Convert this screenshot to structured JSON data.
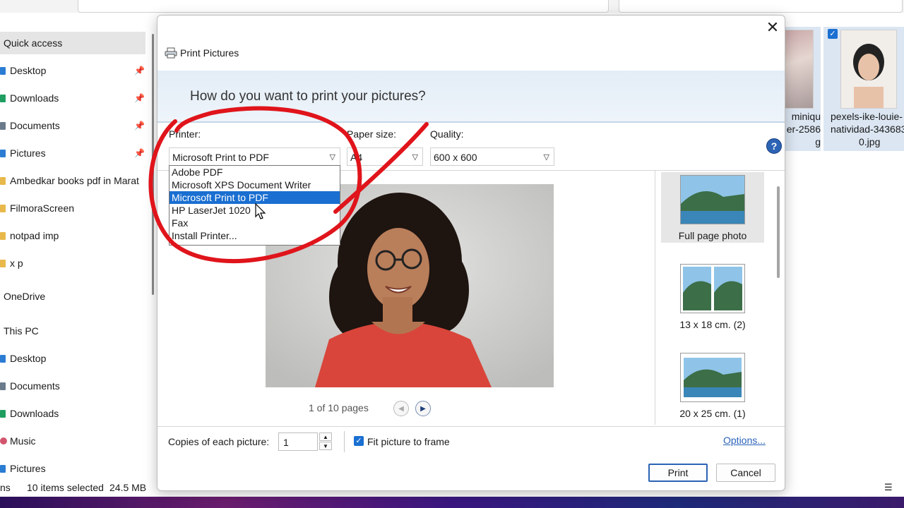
{
  "explorer": {
    "sidebar": {
      "items": [
        {
          "label": "Quick access",
          "color": "#ffffff"
        },
        {
          "label": "Desktop",
          "color": "#2b7cd3"
        },
        {
          "label": "Downloads",
          "color": "#1f9e62"
        },
        {
          "label": "Documents",
          "color": "#6b7b8c"
        },
        {
          "label": "Pictures",
          "color": "#2b7cd3"
        },
        {
          "label": "Ambedkar books pdf in Marat",
          "color": "#e8b84a"
        },
        {
          "label": "FilmoraScreen",
          "color": "#e8b84a"
        },
        {
          "label": "notpad imp",
          "color": "#e8b84a"
        },
        {
          "label": "x p",
          "color": "#e8b84a"
        },
        {
          "label": "OneDrive",
          "color": "#ffffff"
        },
        {
          "label": "This PC",
          "color": "#ffffff"
        },
        {
          "label": "Desktop",
          "color": "#2b7cd3"
        },
        {
          "label": "Documents",
          "color": "#6b7b8c"
        },
        {
          "label": "Downloads",
          "color": "#1f9e62"
        },
        {
          "label": "Music",
          "color": "#d2556d"
        },
        {
          "label": "Pictures",
          "color": "#2b7cd3"
        }
      ],
      "pin_glyph": "📌"
    },
    "thumbnails": [
      {
        "caption_lines": [
          "miniqu",
          "er-2586",
          "g"
        ]
      },
      {
        "caption_lines": [
          "pexels-ike-louie-",
          "natividad-343683",
          "0.jpg"
        ]
      }
    ],
    "status": {
      "prefix": "ns",
      "selection": "10 items selected",
      "size": "24.5 MB"
    }
  },
  "dialog": {
    "title": "Print Pictures",
    "question": "How do you want to print your pictures?",
    "printer": {
      "label": "Printer:",
      "value": "Microsoft Print to PDF"
    },
    "paper": {
      "label": "Paper size:",
      "value": "A4"
    },
    "quality": {
      "label": "Quality:",
      "value": "600 x 600"
    },
    "printer_options": [
      "Adobe PDF",
      "Microsoft XPS Document Writer",
      "Microsoft Print to PDF",
      "HP LaserJet 1020",
      "Fax",
      "Install Printer..."
    ],
    "highlighted_index": 2,
    "pages_text": "1 of 10 pages",
    "layouts": [
      {
        "label": "Full page photo",
        "selected": true
      },
      {
        "label": "13 x 18 cm. (2)",
        "selected": false
      },
      {
        "label": "20 x 25 cm. (1)",
        "selected": false
      }
    ],
    "copies": {
      "label": "Copies of each picture:",
      "value": "1"
    },
    "fit": {
      "label": "Fit picture to frame",
      "checked": true
    },
    "options_link": "Options...",
    "buttons": {
      "print": "Print",
      "cancel": "Cancel"
    },
    "close_glyph": "✕",
    "help_glyph": "?",
    "accent": "#1a6fd1",
    "annotation_color": "#e0141b"
  }
}
